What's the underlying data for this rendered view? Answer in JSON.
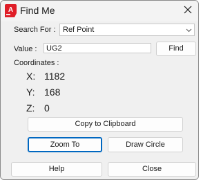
{
  "window": {
    "title": "Find Me",
    "app_icon_letter": "A",
    "app_icon_color": "#e01e28",
    "close_icon": "close-icon"
  },
  "search": {
    "label": "Search For :",
    "selected": "Ref Point"
  },
  "value": {
    "label": "Value :",
    "current": "UG2",
    "find_label": "Find"
  },
  "coordinates": {
    "label": "Coordinates :",
    "x_label": "X:",
    "x_value": "1182",
    "y_label": "Y:",
    "y_value": "168",
    "z_label": "Z:",
    "z_value": "0"
  },
  "actions": {
    "copy_label": "Copy to Clipboard",
    "zoom_label": "Zoom To",
    "draw_label": "Draw Circle",
    "help_label": "Help",
    "close_label": "Close"
  },
  "colors": {
    "accent": "#0067c0",
    "window_bg": "#f0f0f0"
  }
}
